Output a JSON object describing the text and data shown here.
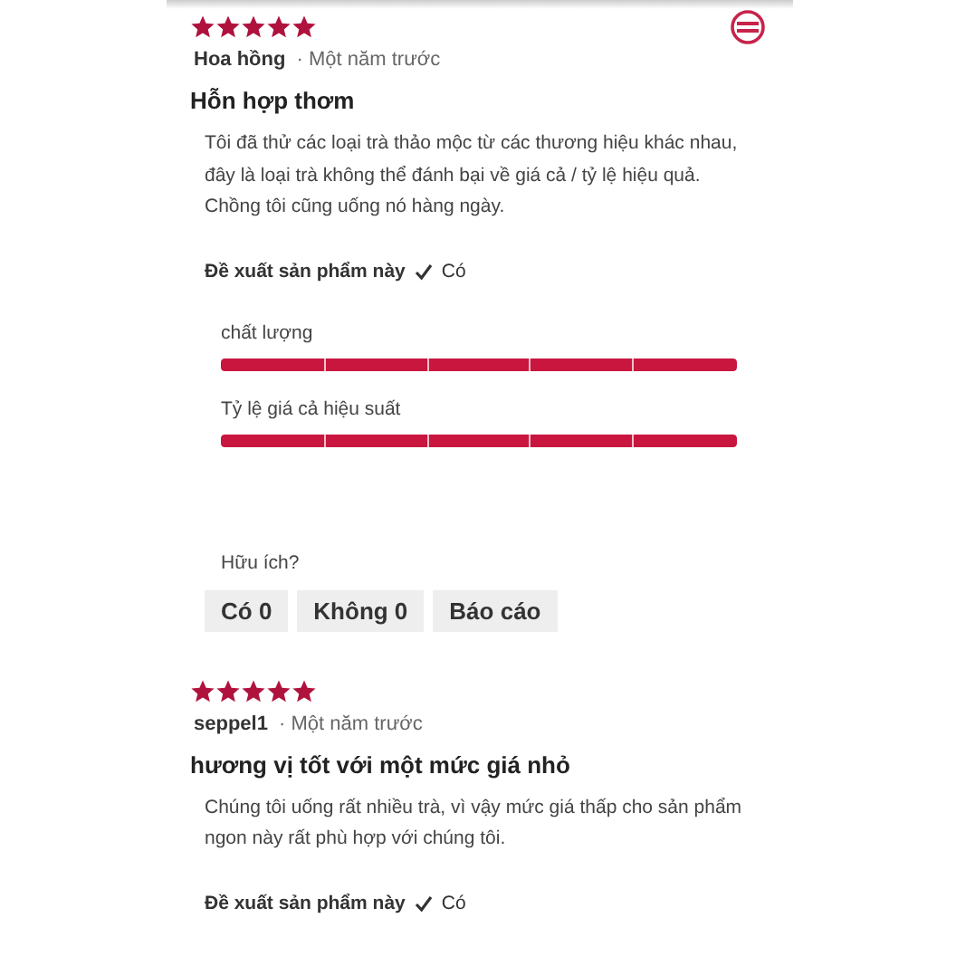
{
  "reviews": [
    {
      "stars": 5,
      "author": "Hoa hồng",
      "date": "· Một năm trước",
      "title": "Hỗn hợp thơm",
      "body": "Tôi đã thử các loại trà thảo mộc từ các thương hiệu khác nhau, đây là loại trà không thể đánh bại về giá cả / tỷ lệ hiệu quả. Chồng tôi cũng uống nó hàng ngày.",
      "recommend_label": "Đề xuất sản phẩm này",
      "recommend_value": "Có",
      "ratings": [
        {
          "label": "chất lượng",
          "level": 1
        },
        {
          "label": "Tỷ lệ giá cả hiệu suất",
          "level": 1
        }
      ],
      "helpful_label": "Hữu ích?",
      "buttons": [
        "Có 0",
        "Không 0",
        "Báo cáo"
      ]
    },
    {
      "stars": 5,
      "author": "seppel1",
      "date": "· Một năm trước",
      "title": "hương vị tốt với một mức giá nhỏ",
      "body": "Chúng tôi uống rất nhiều trà, vì vậy mức giá thấp cho sản phẩm ngon này rất phù hợp với chúng tôi.",
      "recommend_label": "Đề xuất sản phẩm này",
      "recommend_value": "Có"
    }
  ]
}
